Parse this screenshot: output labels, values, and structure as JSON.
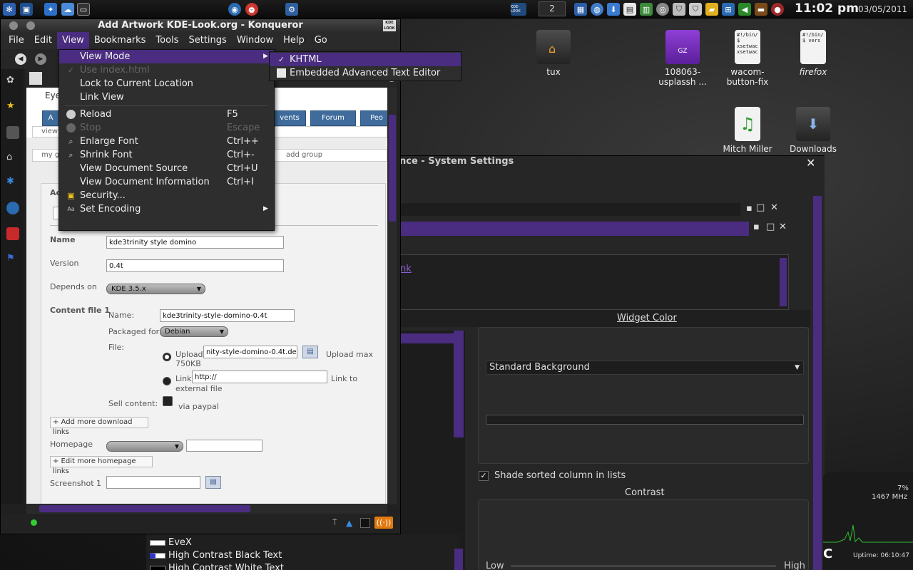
{
  "panel": {
    "desktop_number": "2",
    "clock": "11:02 pm",
    "date": "03/05/2011",
    "tray_badge": "KDE-LOOK"
  },
  "desktop_icons": [
    {
      "label": "tux"
    },
    {
      "label": "108063-usplassh ...",
      "badge": "GZ"
    },
    {
      "label": "wacom-button-fix",
      "doc_text": "#!/bin/ $ xsetwac xsetwac"
    },
    {
      "label": "firefox",
      "doc_text": "#!/bin/ $ vers"
    },
    {
      "label": "Mitch Miller"
    },
    {
      "label": "Downloads"
    }
  ],
  "konqueror": {
    "title": "Add Artwork KDE-Look.org - Konqueror",
    "menus": [
      "File",
      "Edit",
      "View",
      "Bookmarks",
      "Tools",
      "Settings",
      "Window",
      "Help",
      "Go"
    ],
    "page": {
      "header_fragment": "Eye",
      "tabs": [
        "A",
        "vents",
        "Forum",
        "Peo"
      ],
      "subnav": [
        "view",
        "my g",
        "add group"
      ],
      "section_fragment": "Ac",
      "name_label": "Name",
      "name_value": "kde3trinity style domino",
      "version_label": "Version",
      "version_value": "0.4t",
      "depends_label": "Depends on",
      "depends_value": "KDE 3.5.x",
      "content_file_label": "Content file 1",
      "cf_name_label": "Name:",
      "cf_name_value": "kde3trinity-style-domino-0.4t",
      "packaged_label": "Packaged for:",
      "packaged_value": "Debian",
      "file_label": "File:",
      "upload_label": "Upload:",
      "upload_value": "nity-style-domino-0.4t.deb",
      "upload_max": "Upload max",
      "upload_size": "750KB",
      "link_label": "Link:",
      "link_value": "http://",
      "link_to": "Link to",
      "external_file": "external file",
      "sell_label": "Sell content:",
      "via_paypal": "via paypal",
      "add_downloads": "+ Add more download links",
      "homepage_label": "Homepage",
      "edit_homepages": "+ Edit more homepage links",
      "screenshot_label": "Screenshot 1"
    }
  },
  "view_menu": {
    "items": [
      {
        "label": "View Mode",
        "shortcut": "",
        "submenu": true,
        "highlighted": true
      },
      {
        "label": "Use index.html",
        "shortcut": "",
        "disabled": true,
        "icon": "✓"
      },
      {
        "label": "Lock to Current Location",
        "shortcut": ""
      },
      {
        "label": "Link View",
        "shortcut": ""
      },
      {
        "label": "Reload",
        "shortcut": "F5",
        "icon": "◉"
      },
      {
        "label": "Stop",
        "shortcut": "Escape",
        "disabled": true,
        "icon": "◉"
      },
      {
        "label": "Enlarge Font",
        "shortcut": "Ctrl++",
        "icon": "🔍"
      },
      {
        "label": "Shrink Font",
        "shortcut": "Ctrl+-",
        "icon": "🔍"
      },
      {
        "label": "View Document Source",
        "shortcut": "Ctrl+U"
      },
      {
        "label": "View Document Information",
        "shortcut": "Ctrl+I"
      },
      {
        "label": "Security...",
        "shortcut": "",
        "icon": "🔒"
      },
      {
        "label": "Set Encoding",
        "shortcut": "",
        "submenu": true
      }
    ],
    "view_mode_submenu": [
      {
        "label": "KHTML",
        "checked": true
      },
      {
        "label": "Embedded Advanced Text Editor"
      }
    ]
  },
  "system_settings": {
    "title_fragment": "nce - System Settings",
    "link_fragment": "nk",
    "widget_color_label": "Widget Color",
    "widget_color_value": "Standard Background",
    "shade_sorted_label": "Shade sorted column in lists",
    "contrast_label": "Contrast",
    "contrast_low": "Low",
    "contrast_high": "High"
  },
  "color_schemes": [
    "EveX",
    "High Contrast Black Text",
    "High Contrast White Text"
  ],
  "sysmon": {
    "cpu_percent": "7%",
    "cpu_freq": "1467 MHz",
    "uptime": "Uptime: 06:10:47",
    "temp_fragment": "C"
  },
  "colors": {
    "accent": "#4a2c80",
    "web_tab": "#3f6c9c"
  }
}
